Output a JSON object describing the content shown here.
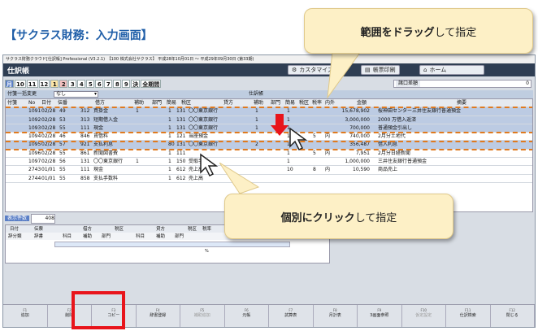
{
  "heading": "【サクラス財務：入力画面】",
  "app": {
    "titlebar": "サクラス財務クラウド[仕訳帳] Professional (V3.2.1)　【100 株式会社サクラス】 平成28年10月01日 ～ 平成29年09月30日 (第33期)",
    "title": "仕訳帳",
    "toolbar": {
      "cust": "カスタマイズ",
      "print": "帳票印刷",
      "home": "ホーム"
    },
    "months": [
      "月",
      "10",
      "11",
      "12",
      "1",
      "2",
      "3",
      "4",
      "5",
      "6",
      "7",
      "8",
      "9",
      "決",
      "全期間"
    ],
    "kouguchi": "諸口差額",
    "kouguchi_val": "0",
    "subbar": {
      "label": "付箋一括変更",
      "value": "なし",
      "section": "仕訳帳"
    },
    "headers": [
      "付箋",
      "No",
      "日付",
      "伝番",
      "借方",
      "補助",
      "部門",
      "簡易",
      "税区",
      "貸方",
      "補助",
      "部門",
      "簡易",
      "税区",
      "税率",
      "内外",
      "金額",
      "摘要"
    ],
    "rows": [
      {
        "no": "1091",
        "date": "02/28",
        "den": "49",
        "kc": "312",
        "kn": "買掛金",
        "h1": "1",
        "b1": "",
        "k1": "1",
        "cc": "131",
        "cn": "〇〇東京銀行",
        "h2": "1",
        "b2": "",
        "k2": "1",
        "rate": "",
        "naigai": "",
        "amt": "15,678,902",
        "memo": "桜神田センター三井住友銀行普通預金"
      },
      {
        "no": "1092",
        "date": "02/28",
        "den": "53",
        "kc": "313",
        "kn": "短期借入金",
        "h1": "",
        "b1": "",
        "k1": "1",
        "cc": "131",
        "cn": "〇〇東京銀行",
        "h2": "1",
        "b2": "",
        "k2": "1",
        "rate": "",
        "naigai": "",
        "amt": "3,000,000",
        "memo": "2000 万借入返済"
      },
      {
        "no": "1093",
        "date": "02/28",
        "den": "55",
        "kc": "111",
        "kn": "現金",
        "h1": "",
        "b1": "",
        "k1": "1",
        "cc": "131",
        "cn": "〇〇東京銀行",
        "h2": "1",
        "b2": "",
        "k2": "1",
        "rate": "",
        "naigai": "",
        "amt": "700,000",
        "memo": "普通預金引出し"
      },
      {
        "no": "1094",
        "date": "02/28",
        "den": "46",
        "kc": "846",
        "kn": "賃借料",
        "h1": "",
        "b1": "",
        "k1": "1",
        "cc": "121",
        "cn": "当座預金",
        "h2": "",
        "b2": "",
        "k2": "1",
        "rate": "5",
        "naigai": "内",
        "amt": "740,000",
        "memo": "2月分土地代"
      },
      {
        "no": "1095",
        "date": "02/28",
        "den": "57",
        "kc": "921",
        "kn": "支払利息",
        "h1": "",
        "b1": "",
        "k1": "80",
        "cc": "131",
        "cn": "〇〇東京銀行",
        "h2": "2",
        "b2": "",
        "k2": "1",
        "rate": "",
        "naigai": "",
        "amt": "356,487",
        "memo": "借入利息"
      },
      {
        "no": "1096",
        "date": "02/28",
        "den": "55",
        "kc": "861",
        "kn": "新聞図書費",
        "h1": "",
        "b1": "",
        "k1": "1",
        "cc": "111",
        "cn": "",
        "h2": "",
        "b2": "",
        "k2": "1",
        "rate": "5",
        "naigai": "内",
        "amt": "7,951",
        "memo": "2月分日経新聞"
      },
      {
        "no": "1097",
        "date": "02/28",
        "den": "56",
        "kc": "131",
        "kn": "〇〇東京銀行",
        "h1": "1",
        "b1": "",
        "k1": "1",
        "cc": "150",
        "cn": "受取手形",
        "h2": "",
        "b2": "",
        "k2": "1",
        "rate": "",
        "naigai": "",
        "amt": "1,000,000",
        "memo": "三井住友銀行普通預金"
      },
      {
        "no": "2743",
        "date": "01/01",
        "den": "55",
        "kc": "111",
        "kn": "現金",
        "h1": "",
        "b1": "",
        "k1": "1",
        "cc": "612",
        "cn": "売上高",
        "h2": "",
        "b2": "",
        "k2": "10",
        "rate": "8",
        "naigai": "内",
        "amt": "10,590",
        "memo": "商品売上"
      },
      {
        "no": "2744",
        "date": "01/01",
        "den": "55",
        "kc": "858",
        "kn": "支払手数料",
        "h1": "",
        "b1": "",
        "k1": "1",
        "cc": "612",
        "cn": "売上高",
        "h2": "",
        "b2": "",
        "k2": "",
        "rate": "",
        "naigai": "",
        "amt": "",
        "memo": ""
      }
    ],
    "count_label": "表示件数",
    "count_value": "408",
    "entry_headers": [
      "日付",
      "伝票",
      "借方",
      "税区",
      "貸方",
      "税区",
      "税率",
      "金額"
    ],
    "entry_sub": [
      "辞分類",
      "辞書",
      "科目",
      "補助",
      "部門",
      "科目",
      "補助",
      "部門",
      "%"
    ],
    "fkeys": [
      {
        "num": "F1",
        "label": "追加"
      },
      {
        "num": "F2",
        "label": "削除"
      },
      {
        "num": "F3",
        "label": "コピー"
      },
      {
        "num": "F4",
        "label": "辞書登録"
      },
      {
        "num": "F5",
        "label": "補助追加"
      },
      {
        "num": "F6",
        "label": "元帳"
      },
      {
        "num": "F7",
        "label": "試算表"
      },
      {
        "num": "F8",
        "label": "月計表"
      },
      {
        "num": "F9",
        "label": "3画面参照"
      },
      {
        "num": "F10",
        "label": "仮定設定"
      },
      {
        "num": "F11",
        "label": "仕訳検索"
      },
      {
        "num": "F12",
        "label": "閉じる"
      }
    ]
  },
  "callouts": {
    "drag_bold": "範囲をドラッグ",
    "drag_rest": "して指定",
    "click_bold": "個別にクリック",
    "click_rest": "して指定"
  },
  "colors": {
    "accent": "#1f5ea8",
    "highlight": "#e8141b",
    "dash": "#e07a1f",
    "callout": "#fdf0c6"
  }
}
